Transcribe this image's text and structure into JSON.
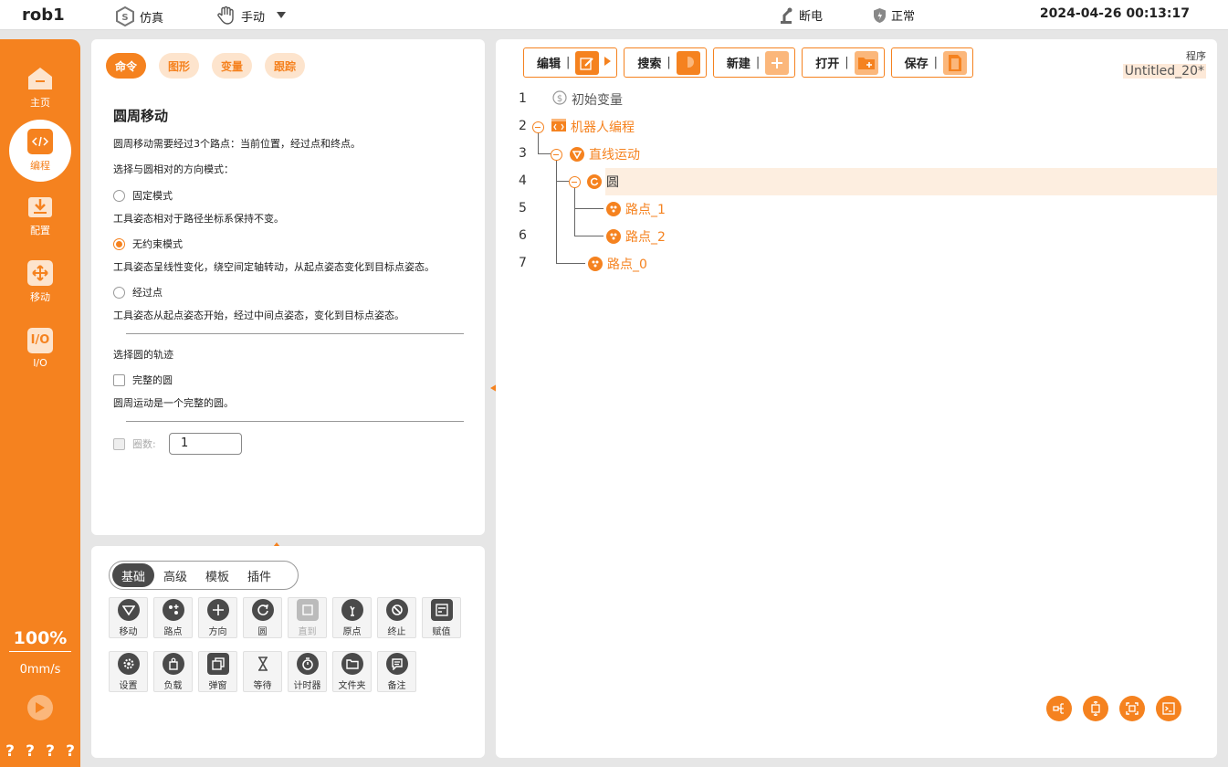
{
  "topbar": {
    "robot_name": "rob1",
    "sim_label": "仿真",
    "mode_label": "手动",
    "power_label": "断电",
    "status_label": "正常",
    "datetime": "2024-04-26 00:13:17"
  },
  "sidebar": {
    "items": [
      {
        "label": "主页",
        "icon": "home-icon"
      },
      {
        "label": "编程",
        "icon": "code-icon"
      },
      {
        "label": "配置",
        "icon": "download-icon"
      },
      {
        "label": "移动",
        "icon": "move-icon"
      },
      {
        "label": "I/O",
        "icon": "io-icon"
      }
    ],
    "speed_percent": "100%",
    "speed_value": "0mm/s",
    "bottom_marks": [
      "?",
      "?",
      "?",
      "?"
    ]
  },
  "command_panel": {
    "tabs": [
      "命令",
      "图形",
      "变量",
      "跟踪"
    ],
    "active_tab": "命令",
    "title": "圆周移动",
    "desc": "圆周移动需要经过3个路点：当前位置，经过点和终点。",
    "orientation_prompt": "选择与圆相对的方向模式：",
    "options": [
      {
        "label": "固定模式",
        "desc": "工具姿态相对于路径坐标系保持不变。",
        "selected": false
      },
      {
        "label": "无约束模式",
        "desc": "工具姿态呈线性变化，绕空间定轴转动，从起点姿态变化到目标点姿态。",
        "selected": true
      },
      {
        "label": "经过点",
        "desc": "工具姿态从起点姿态开始，经过中间点姿态，变化到目标点姿态。",
        "selected": false
      }
    ],
    "trajectory_prompt": "选择圆的轨迹",
    "full_circle_label": "完整的圆",
    "full_circle_desc": "圆周运动是一个完整的圆。",
    "laps_label": "圈数:",
    "laps_value": "1"
  },
  "palette": {
    "tabs": [
      "基础",
      "高级",
      "模板",
      "插件"
    ],
    "active_tab": "基础",
    "row1": [
      {
        "label": "移动",
        "icon": "move-heart-icon",
        "disabled": false
      },
      {
        "label": "路点",
        "icon": "waypoint-icon",
        "disabled": false
      },
      {
        "label": "方向",
        "icon": "direction-icon",
        "disabled": false
      },
      {
        "label": "圆",
        "icon": "circle-arrow-icon",
        "disabled": false
      },
      {
        "label": "直到",
        "icon": "until-icon",
        "disabled": true
      },
      {
        "label": "原点",
        "icon": "origin-icon",
        "disabled": false
      },
      {
        "label": "终止",
        "icon": "stop-icon",
        "disabled": false
      },
      {
        "label": "赋值",
        "icon": "assign-icon",
        "disabled": false
      }
    ],
    "row2": [
      {
        "label": "设置",
        "icon": "settings-icon",
        "disabled": false
      },
      {
        "label": "负载",
        "icon": "payload-icon",
        "disabled": false
      },
      {
        "label": "弹窗",
        "icon": "popup-icon",
        "disabled": false
      },
      {
        "label": "等待",
        "icon": "hourglass-icon",
        "disabled": false
      },
      {
        "label": "计时器",
        "icon": "timer-icon",
        "disabled": false
      },
      {
        "label": "文件夹",
        "icon": "folder-icon",
        "disabled": false
      },
      {
        "label": "备注",
        "icon": "comment-icon",
        "disabled": false
      }
    ]
  },
  "program": {
    "toolbar": [
      "编辑",
      "搜索",
      "新建",
      "打开",
      "保存"
    ],
    "label": "程序",
    "name": "Untitled_20*",
    "lines": [
      {
        "no": "1",
        "text": "初始变量"
      },
      {
        "no": "2",
        "text": "机器人编程"
      },
      {
        "no": "3",
        "text": "直线运动"
      },
      {
        "no": "4",
        "text": "圆"
      },
      {
        "no": "5",
        "text": "路点_1"
      },
      {
        "no": "6",
        "text": "路点_2"
      },
      {
        "no": "7",
        "text": "路点_0"
      }
    ]
  },
  "colors": {
    "accent": "#f5821f",
    "accent_light": "#fde4cd",
    "background": "#e6e6e6"
  }
}
